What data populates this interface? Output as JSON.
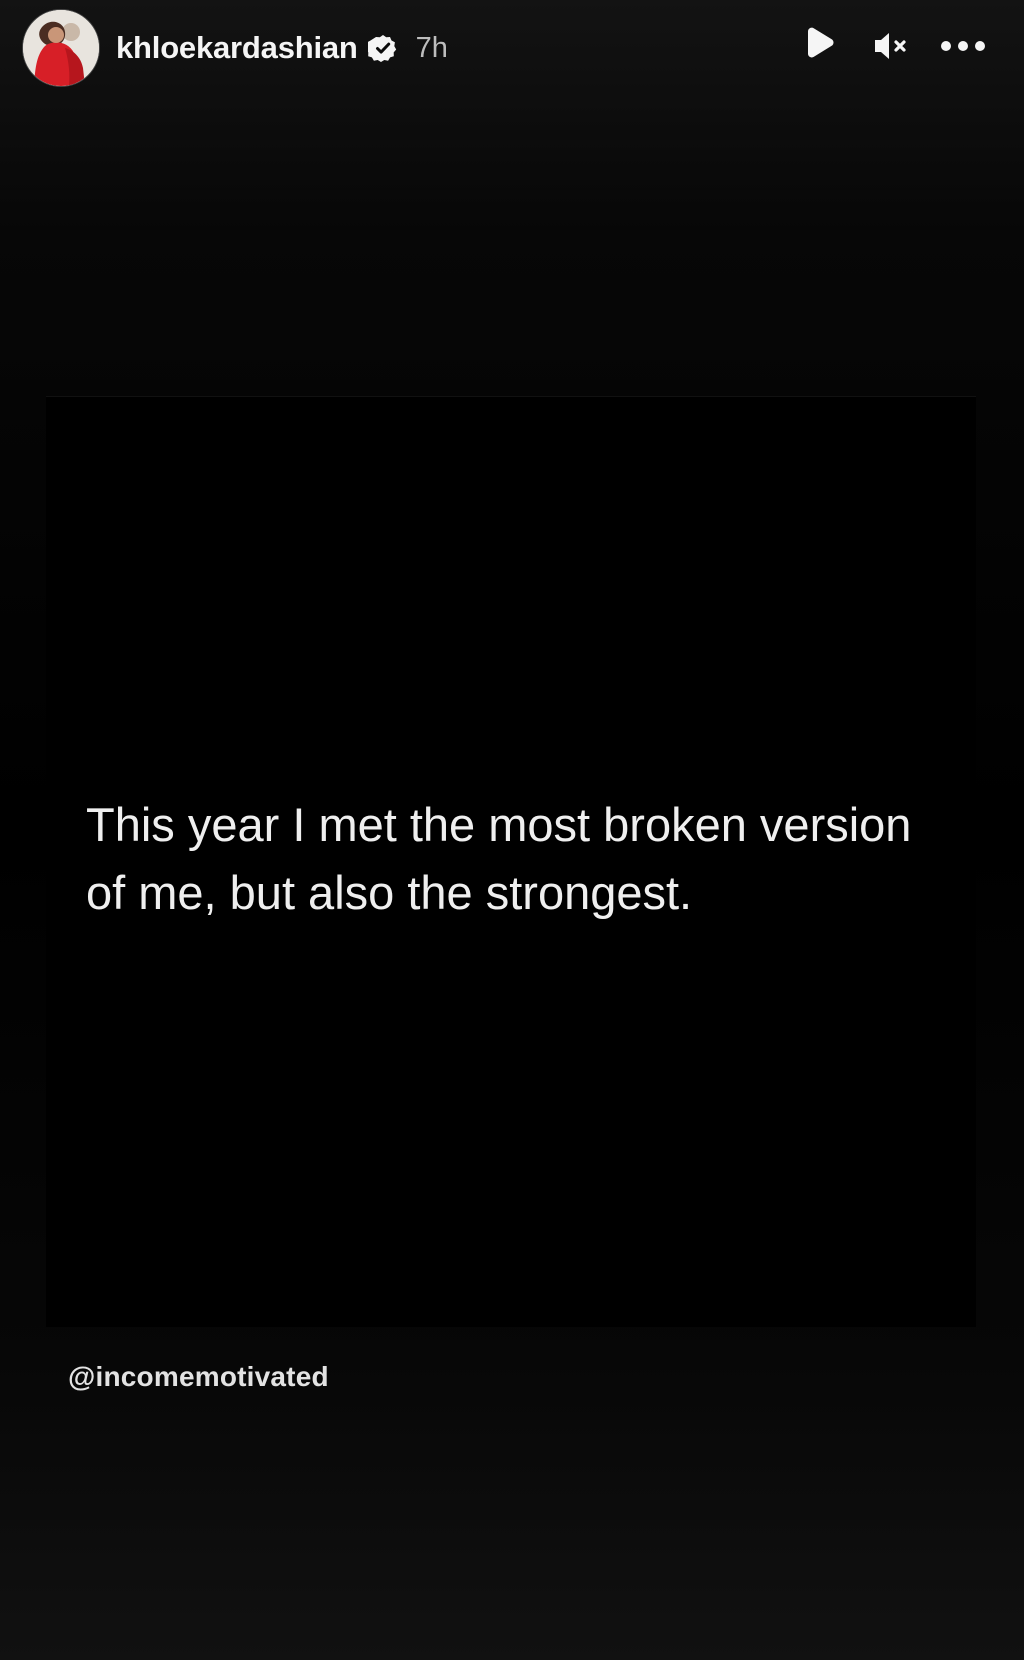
{
  "header": {
    "username": "khloekardashian",
    "time": "7h",
    "icons": {
      "avatar": "profile-avatar",
      "verified": "verified-badge-icon",
      "play": "play-icon",
      "mute": "volume-muted-icon",
      "more": "more-options-icon"
    }
  },
  "post": {
    "quote": "This year I met the most broken version of me, but also the strongest.",
    "credit": "@incomemotivated"
  },
  "colors": {
    "background": "#000000",
    "text": "#efefef",
    "time": "#bdbdbd",
    "avatar_accent": "#d71f27"
  }
}
